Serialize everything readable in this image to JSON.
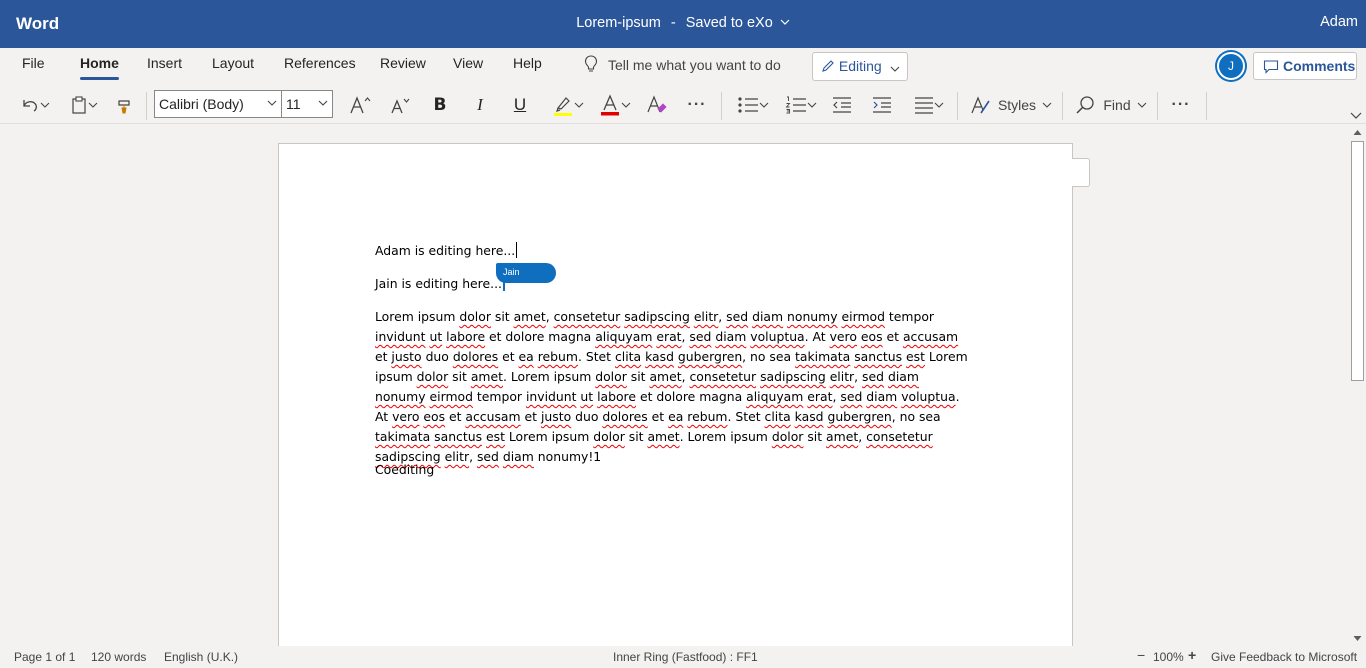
{
  "titlebar": {
    "app_name": "Word",
    "doc_title": "Lorem-ipsum",
    "separator": "-",
    "save_status": "Saved to eXo",
    "user": "Adam"
  },
  "tabs": [
    {
      "label": "File",
      "active": false
    },
    {
      "label": "Home",
      "active": true
    },
    {
      "label": "Insert",
      "active": false
    },
    {
      "label": "Layout",
      "active": false
    },
    {
      "label": "References",
      "active": false
    },
    {
      "label": "Review",
      "active": false
    },
    {
      "label": "View",
      "active": false
    },
    {
      "label": "Help",
      "active": false
    }
  ],
  "tell_me": "Tell me what you want to do",
  "editing_mode": "Editing",
  "coauthor_initial": "J",
  "comments_label": "Comments",
  "toolbar": {
    "font_name": "Calibri (Body)",
    "font_size": "11",
    "styles_label": "Styles",
    "find_label": "Find",
    "more": "···",
    "highlight_color": "#ffff00",
    "font_color": "#e00000"
  },
  "document": {
    "line1": "Adam is editing here...",
    "line2": "Jain is editing here...",
    "coauthor_flag": "Jain",
    "paragraph": [
      [
        "Lorem ipsum ",
        false
      ],
      [
        "dolor",
        true
      ],
      [
        " sit ",
        false
      ],
      [
        "amet",
        true
      ],
      [
        ", ",
        false
      ],
      [
        "consetetur",
        true
      ],
      [
        " ",
        false
      ],
      [
        "sadipscing",
        true
      ],
      [
        " ",
        false
      ],
      [
        "elitr",
        true
      ],
      [
        ", ",
        false
      ],
      [
        "sed",
        true
      ],
      [
        " ",
        false
      ],
      [
        "diam",
        true
      ],
      [
        " ",
        false
      ],
      [
        "nonumy",
        true
      ],
      [
        " ",
        false
      ],
      [
        "eirmod",
        true
      ],
      [
        " tempor ",
        false
      ],
      [
        "invidunt",
        true
      ],
      [
        " ",
        false
      ],
      [
        "ut",
        true
      ],
      [
        " ",
        false
      ],
      [
        "labore",
        true
      ],
      [
        " et dolore magna ",
        false
      ],
      [
        "aliquyam",
        true
      ],
      [
        " ",
        false
      ],
      [
        "erat",
        true
      ],
      [
        ", ",
        false
      ],
      [
        "sed",
        true
      ],
      [
        " ",
        false
      ],
      [
        "diam",
        true
      ],
      [
        " ",
        false
      ],
      [
        "voluptua",
        true
      ],
      [
        ". At ",
        false
      ],
      [
        "vero",
        true
      ],
      [
        " ",
        false
      ],
      [
        "eos",
        true
      ],
      [
        " et ",
        false
      ],
      [
        "accusam",
        true
      ],
      [
        " et ",
        false
      ],
      [
        "justo",
        true
      ],
      [
        " duo ",
        false
      ],
      [
        "dolores",
        true
      ],
      [
        " et ",
        false
      ],
      [
        "ea",
        true
      ],
      [
        " ",
        false
      ],
      [
        "rebum",
        true
      ],
      [
        ". Stet ",
        false
      ],
      [
        "clita",
        true
      ],
      [
        " ",
        false
      ],
      [
        "kasd",
        true
      ],
      [
        " ",
        false
      ],
      [
        "gubergren",
        true
      ],
      [
        ", no sea ",
        false
      ],
      [
        "takimata",
        true
      ],
      [
        " ",
        false
      ],
      [
        "sanctus",
        true
      ],
      [
        " ",
        false
      ],
      [
        "est",
        true
      ],
      [
        " Lorem ipsum ",
        false
      ],
      [
        "dolor",
        true
      ],
      [
        " sit ",
        false
      ],
      [
        "amet",
        true
      ],
      [
        ". Lorem ipsum ",
        false
      ],
      [
        "dolor",
        true
      ],
      [
        " sit ",
        false
      ],
      [
        "amet",
        true
      ],
      [
        ", ",
        false
      ],
      [
        "consetetur",
        true
      ],
      [
        " ",
        false
      ],
      [
        "sadipscing",
        true
      ],
      [
        " ",
        false
      ],
      [
        "elitr",
        true
      ],
      [
        ", ",
        false
      ],
      [
        "sed",
        true
      ],
      [
        " ",
        false
      ],
      [
        "diam",
        true
      ],
      [
        " ",
        false
      ],
      [
        "nonumy",
        true
      ],
      [
        " ",
        false
      ],
      [
        "eirmod",
        true
      ],
      [
        " tempor ",
        false
      ],
      [
        "invidunt",
        true
      ],
      [
        " ",
        false
      ],
      [
        "ut",
        true
      ],
      [
        " ",
        false
      ],
      [
        "labore",
        true
      ],
      [
        " et dolore magna ",
        false
      ],
      [
        "aliquyam",
        true
      ],
      [
        " ",
        false
      ],
      [
        "erat",
        true
      ],
      [
        ", ",
        false
      ],
      [
        "sed",
        true
      ],
      [
        " ",
        false
      ],
      [
        "diam",
        true
      ],
      [
        " ",
        false
      ],
      [
        "voluptua",
        true
      ],
      [
        ". At ",
        false
      ],
      [
        "vero",
        true
      ],
      [
        " ",
        false
      ],
      [
        "eos",
        true
      ],
      [
        " et ",
        false
      ],
      [
        "accusam",
        true
      ],
      [
        " et ",
        false
      ],
      [
        "justo",
        true
      ],
      [
        " duo ",
        false
      ],
      [
        "dolores",
        true
      ],
      [
        " et ",
        false
      ],
      [
        "ea",
        true
      ],
      [
        " ",
        false
      ],
      [
        "rebum",
        true
      ],
      [
        ". Stet ",
        false
      ],
      [
        "clita",
        true
      ],
      [
        " ",
        false
      ],
      [
        "kasd",
        true
      ],
      [
        " ",
        false
      ],
      [
        "gubergren",
        true
      ],
      [
        ", no sea ",
        false
      ],
      [
        "takimata",
        true
      ],
      [
        " ",
        false
      ],
      [
        "sanctus",
        true
      ],
      [
        " ",
        false
      ],
      [
        "est",
        true
      ],
      [
        " Lorem ipsum ",
        false
      ],
      [
        "dolor",
        true
      ],
      [
        " sit ",
        false
      ],
      [
        "amet",
        true
      ],
      [
        ". Lorem ipsum ",
        false
      ],
      [
        "dolor",
        true
      ],
      [
        " sit ",
        false
      ],
      [
        "amet",
        true
      ],
      [
        ", ",
        false
      ],
      [
        "consetetur",
        true
      ],
      [
        " ",
        false
      ],
      [
        "sadipscing",
        true
      ],
      [
        " ",
        false
      ],
      [
        "elitr",
        true
      ],
      [
        ", ",
        false
      ],
      [
        "sed",
        true
      ],
      [
        " ",
        false
      ],
      [
        "diam",
        true
      ],
      [
        " nonumy!1",
        false
      ]
    ],
    "line4": "Coediting"
  },
  "status": {
    "page": "Page 1 of 1",
    "words": "120 words",
    "language": "English (U.K.)",
    "ring": "Inner Ring (Fastfood) : FF1",
    "zoom_out": "−",
    "zoom": "100%",
    "zoom_in": "+",
    "feedback": "Give Feedback to Microsoft"
  }
}
